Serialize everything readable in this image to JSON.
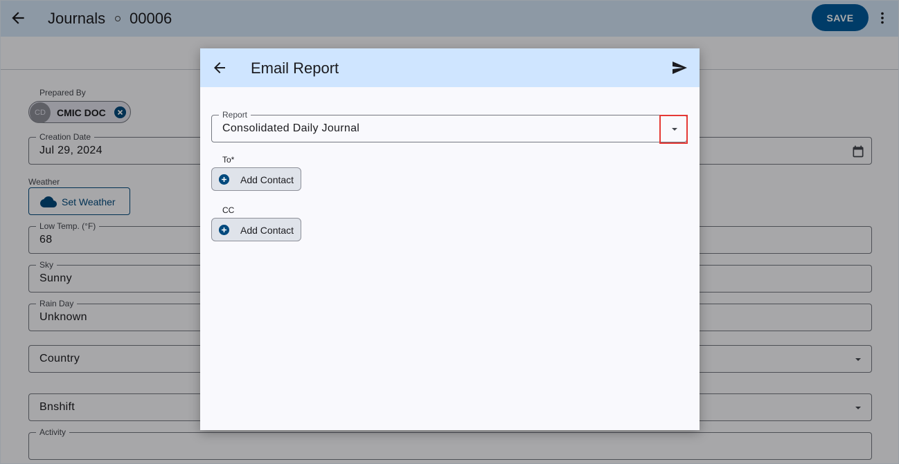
{
  "appbar": {
    "title": "Journals",
    "doc_number": "00006",
    "save_label": "SAVE"
  },
  "form": {
    "prepared_by": {
      "label": "Prepared By",
      "chip_initials": "CD",
      "chip_name": "CMIC DOC"
    },
    "creation_date": {
      "label": "Creation Date",
      "value": "Jul 29, 2024"
    },
    "weather": {
      "label": "Weather",
      "button_label": "Set Weather"
    },
    "low_temp": {
      "label": "Low Temp. (°F)",
      "value": "68"
    },
    "sky": {
      "label": "Sky",
      "value": "Sunny"
    },
    "rain_day": {
      "label": "Rain Day",
      "value": "Unknown"
    },
    "country": {
      "placeholder": "Country"
    },
    "bnshift": {
      "placeholder": "Bnshift"
    },
    "activity": {
      "label": "Activity",
      "value": ""
    }
  },
  "dialog": {
    "title": "Email Report",
    "report": {
      "label": "Report",
      "value": "Consolidated Daily Journal"
    },
    "to": {
      "label": "To*",
      "button_label": "Add Contact"
    },
    "cc": {
      "label": "CC",
      "button_label": "Add Contact"
    }
  },
  "colors": {
    "appbar_bg": "#d3e4f7",
    "primary": "#005a9c",
    "dialog_header_bg": "#cfe5ff",
    "highlight": "#e53935"
  }
}
